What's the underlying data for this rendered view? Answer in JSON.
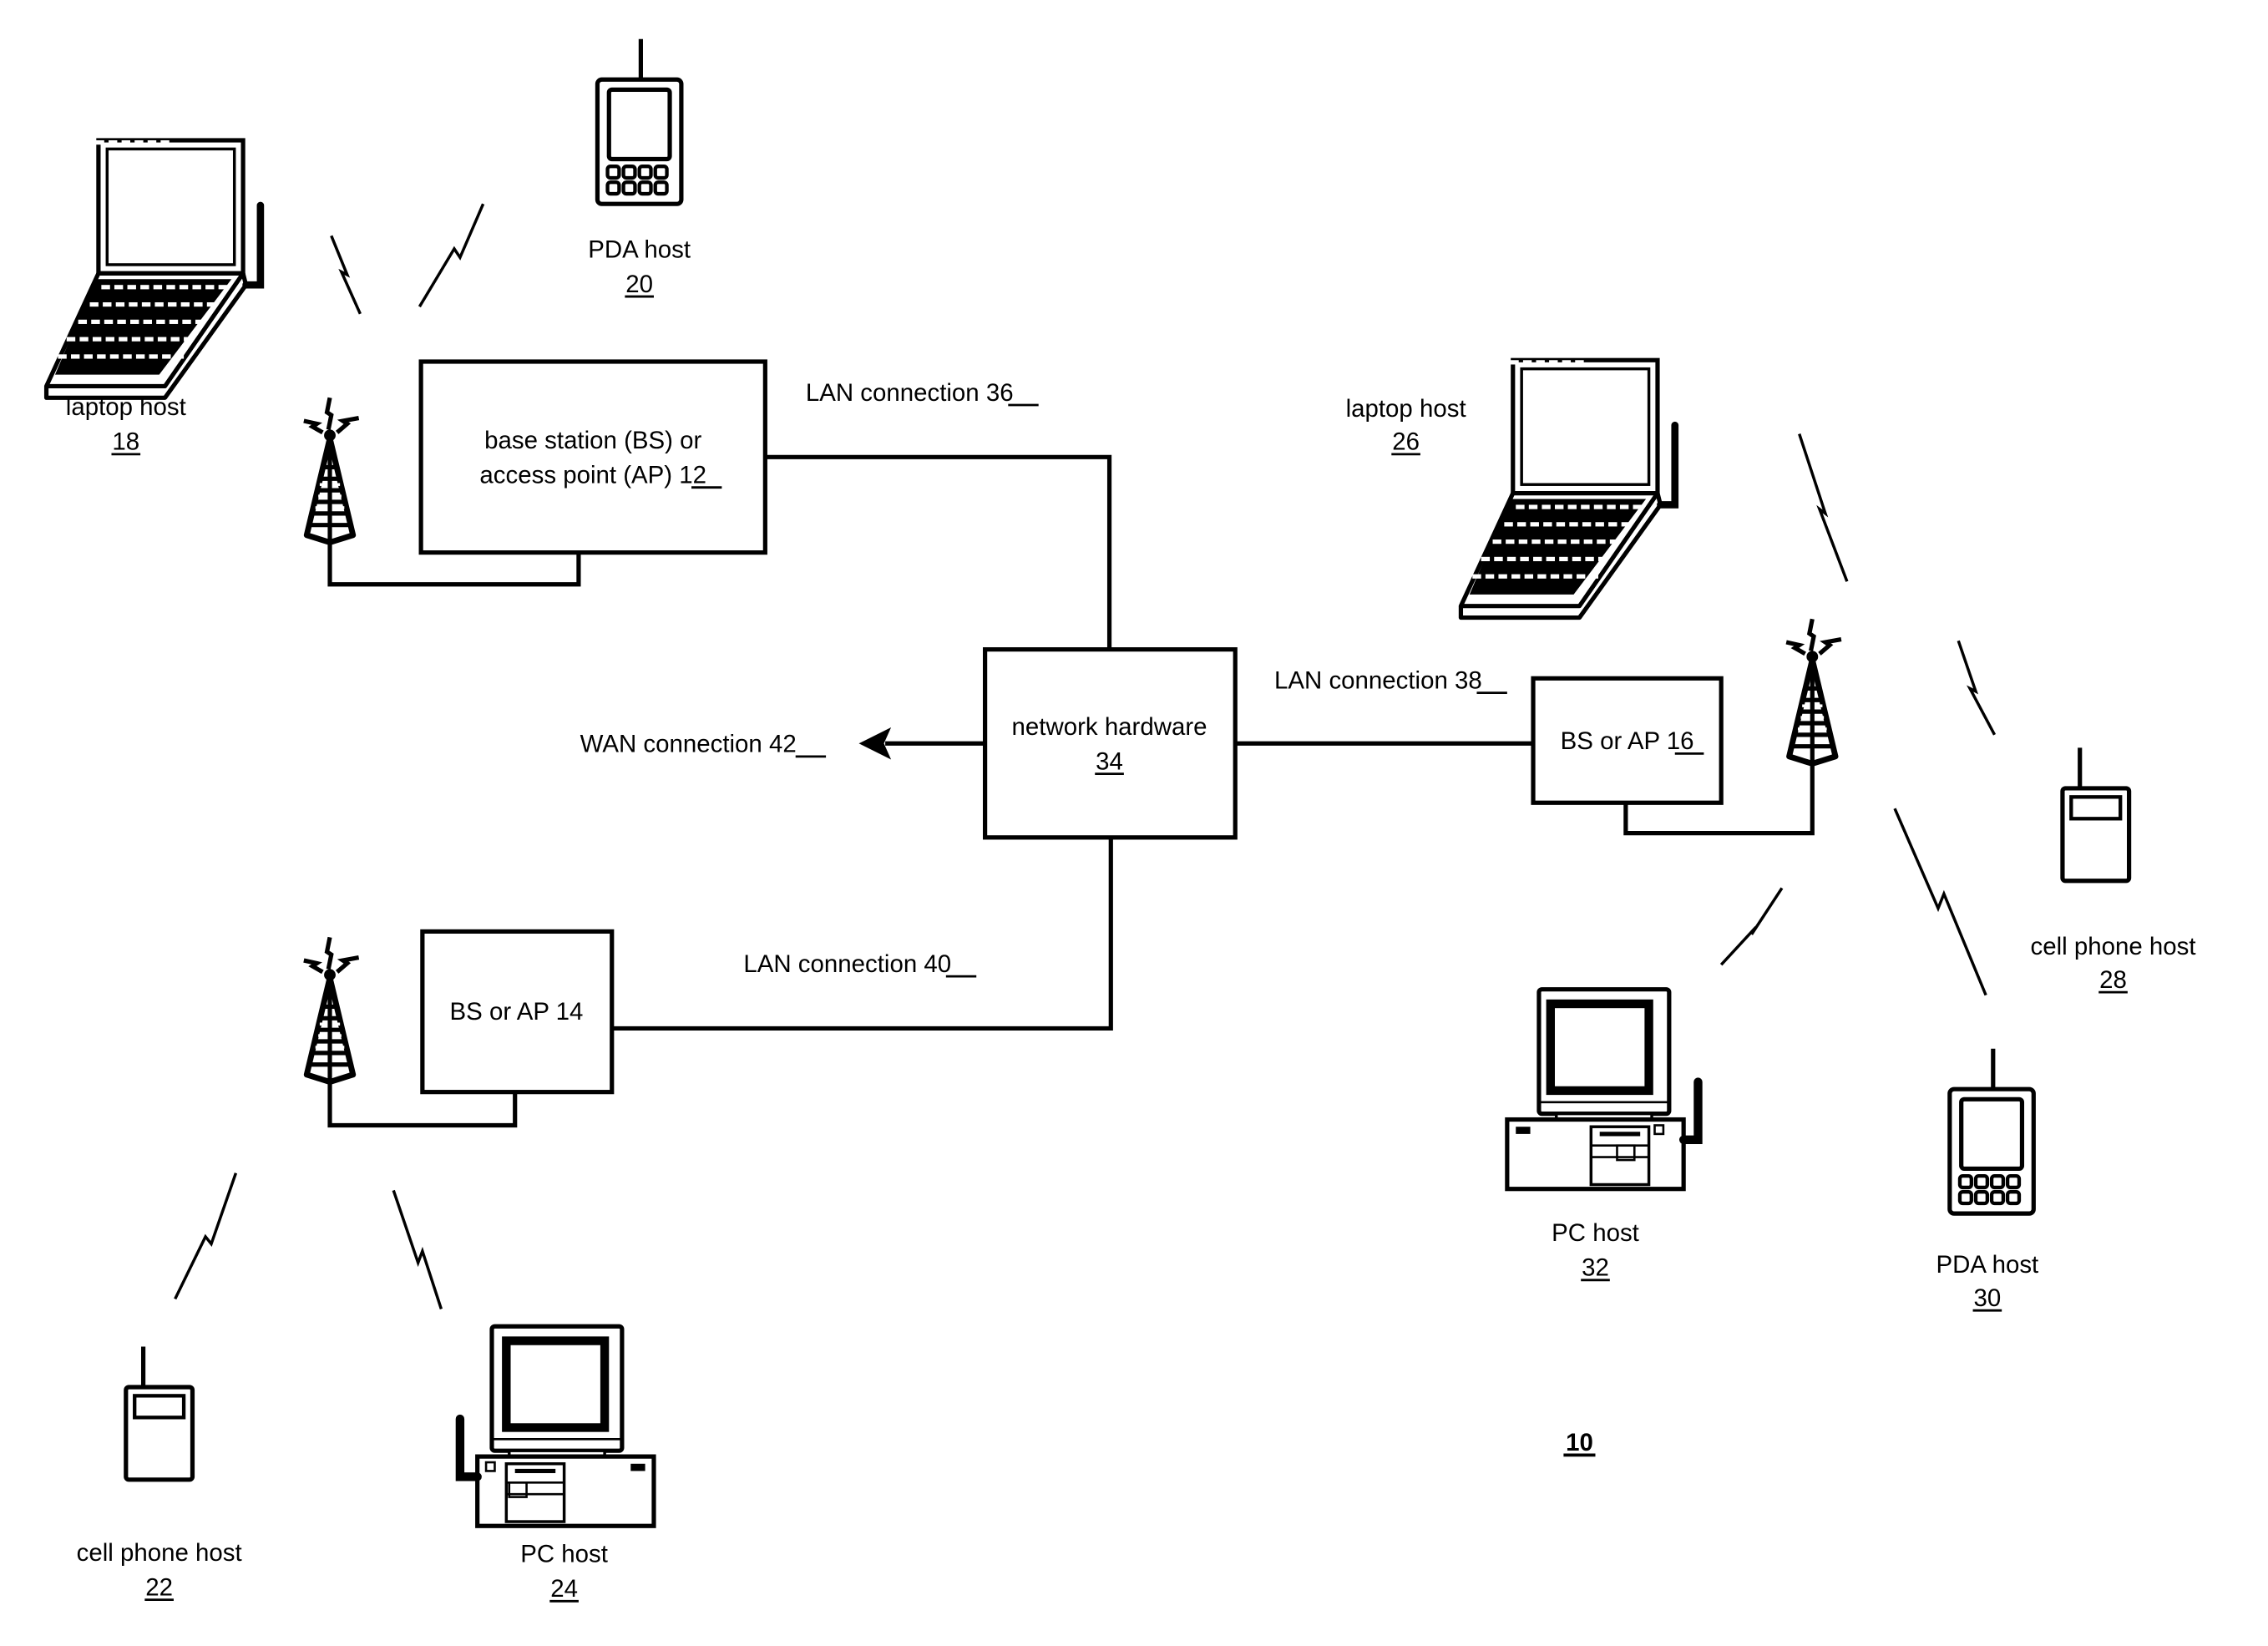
{
  "figure": {
    "reference": "10",
    "colors": {
      "ink": "#000000",
      "background": "#ffffff"
    }
  },
  "nodes": {
    "bs12": {
      "line1": "base station (BS) or",
      "line2_prefix": "access point (AP) ",
      "ref": "12",
      "icon": "tower-icon"
    },
    "bs14": {
      "label": "BS or AP 14",
      "icon": "tower-icon"
    },
    "bs16": {
      "label_prefix": "BS or AP ",
      "ref": "16",
      "icon": "tower-icon"
    },
    "network_hardware": {
      "label": "network hardware",
      "ref": "34"
    }
  },
  "connections": {
    "lan36": {
      "label_prefix": "LAN connection ",
      "ref": "36"
    },
    "lan38": {
      "label_prefix": "LAN connection ",
      "ref": "38"
    },
    "lan40": {
      "label_prefix": "LAN connection ",
      "ref": "40"
    },
    "wan42": {
      "label_prefix": "WAN connection ",
      "ref": "42"
    }
  },
  "hosts": {
    "laptop18": {
      "label": "laptop host",
      "ref": "18",
      "icon": "laptop-icon"
    },
    "pda20": {
      "label": "PDA host",
      "ref": "20",
      "icon": "pda-icon"
    },
    "cell22": {
      "label": "cell phone host",
      "ref": "22",
      "icon": "cell-phone-icon"
    },
    "pc24": {
      "label": "PC host",
      "ref": "24",
      "icon": "pc-icon"
    },
    "laptop26": {
      "label": "laptop host",
      "ref": "26",
      "icon": "laptop-icon"
    },
    "cell28": {
      "label": "cell phone host",
      "ref": "28",
      "icon": "cell-phone-icon"
    },
    "pda30": {
      "label": "PDA host",
      "ref": "30",
      "icon": "pda-icon"
    },
    "pc32": {
      "label": "PC host",
      "ref": "32",
      "icon": "pc-icon"
    }
  }
}
